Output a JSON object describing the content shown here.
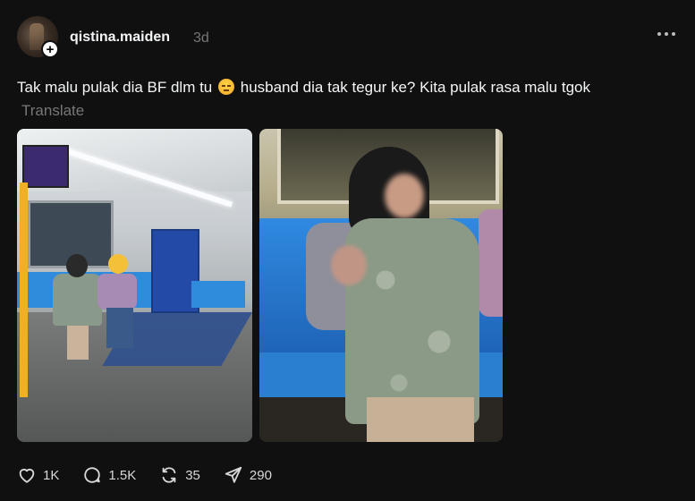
{
  "header": {
    "username": "qistina.maiden",
    "time": "3d"
  },
  "post": {
    "text": "Tak malu pulak dia BF dlm tu",
    "text_after_emoji": "husband dia tak tegur ke? Kita pulak rasa malu tgok",
    "emoji": "unamused-face-emoji",
    "translate_label": "Translate"
  },
  "images": [
    {
      "icon": "photo-train-carriage"
    },
    {
      "icon": "photo-woman-nursing-cover"
    }
  ],
  "actions": {
    "likes": "1K",
    "replies": "1.5K",
    "reposts": "35",
    "shares": "290"
  },
  "colors": {
    "background": "#101010",
    "text": "#f3f5f7",
    "muted": "#777777"
  }
}
